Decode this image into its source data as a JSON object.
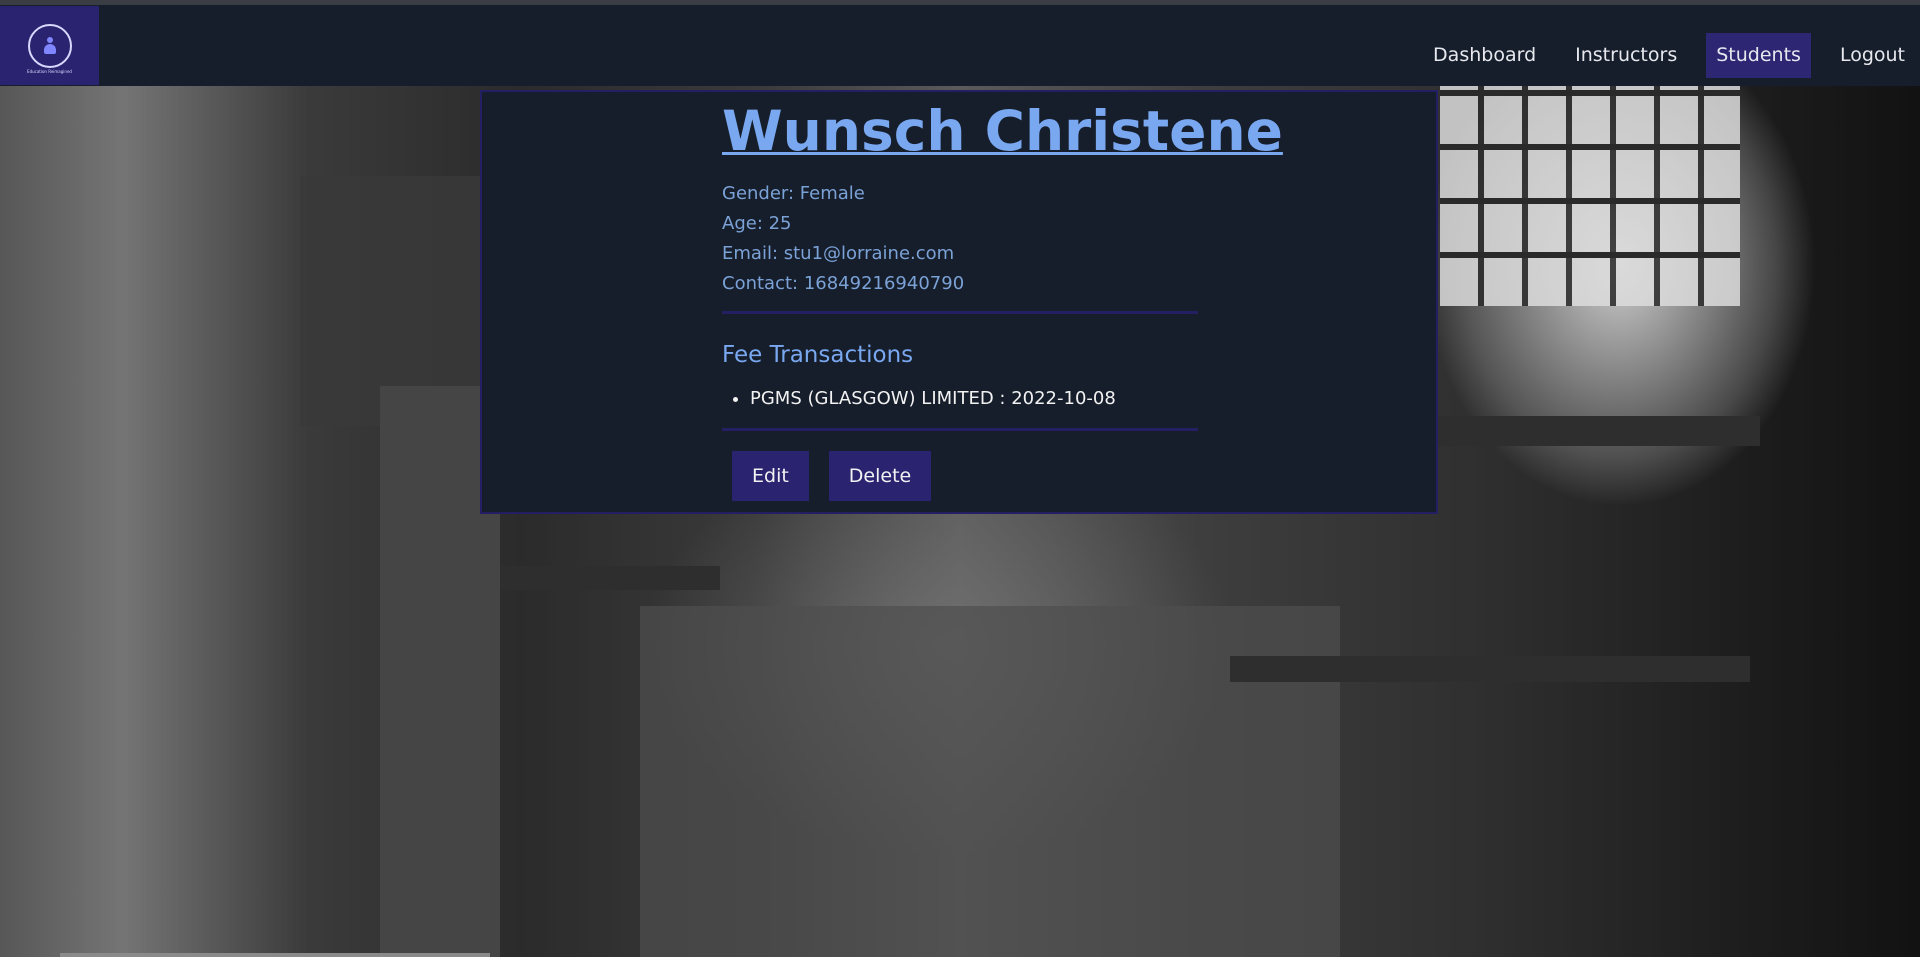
{
  "navbar": {
    "logo_alt": "Lorraine School logo",
    "logo_tagline": "Education Reimagined",
    "links": [
      {
        "label": "Dashboard"
      },
      {
        "label": "Instructors"
      },
      {
        "label": "Students",
        "active": true
      },
      {
        "label": "Logout"
      }
    ]
  },
  "student": {
    "name": "Wunsch Christene",
    "gender": "Gender: Female",
    "age": "Age: 25",
    "email": "Email: stu1@lorraine.com",
    "contact": "Contact: 16849216940790"
  },
  "fees": {
    "title": "Fee Transactions",
    "items": [
      "PGMS (GLASGOW) LIMITED : 2022-10-08"
    ]
  },
  "actions": {
    "edit_label": "Edit",
    "delete_label": "Delete"
  },
  "colors": {
    "navbar_bg": "#161d2b",
    "accent": "#2a2370",
    "name_color": "#79a8f0",
    "info_color": "#7ba2d6"
  }
}
